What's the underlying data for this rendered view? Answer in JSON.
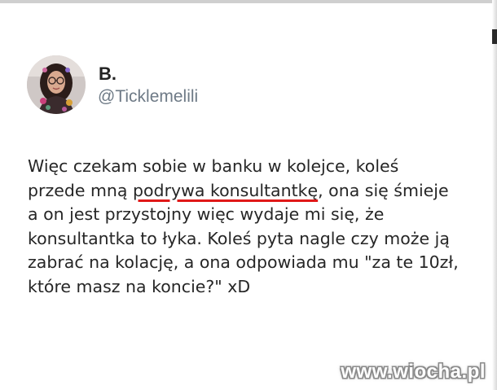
{
  "tweet": {
    "author_name": "B.",
    "author_handle": "@Ticklemelili",
    "lines": [
      {
        "before": "Więc czekam sobie w banku w kolejce, koleś",
        "highlight": "",
        "after": ""
      },
      {
        "before": "przede mną ",
        "highlight": "podrywa konsultantkę",
        "after": ", ona się śmieje"
      },
      {
        "before": "a on jest przystojny więc wydaje mi się, że",
        "highlight": "",
        "after": ""
      },
      {
        "before": "konsultantka to łyka. Koleś pyta nagle czy może ją",
        "highlight": "",
        "after": ""
      },
      {
        "before": "zabrać na kolację, a ona odpowiada mu \"za te 10zł,",
        "highlight": "",
        "after": ""
      },
      {
        "before": "które masz na koncie?\" xD",
        "highlight": "",
        "after": ""
      }
    ],
    "underline_color": "#e01818"
  },
  "watermark": {
    "text": "www.wiocha.pl"
  },
  "icons": {
    "avatar": "avatar-photo"
  }
}
